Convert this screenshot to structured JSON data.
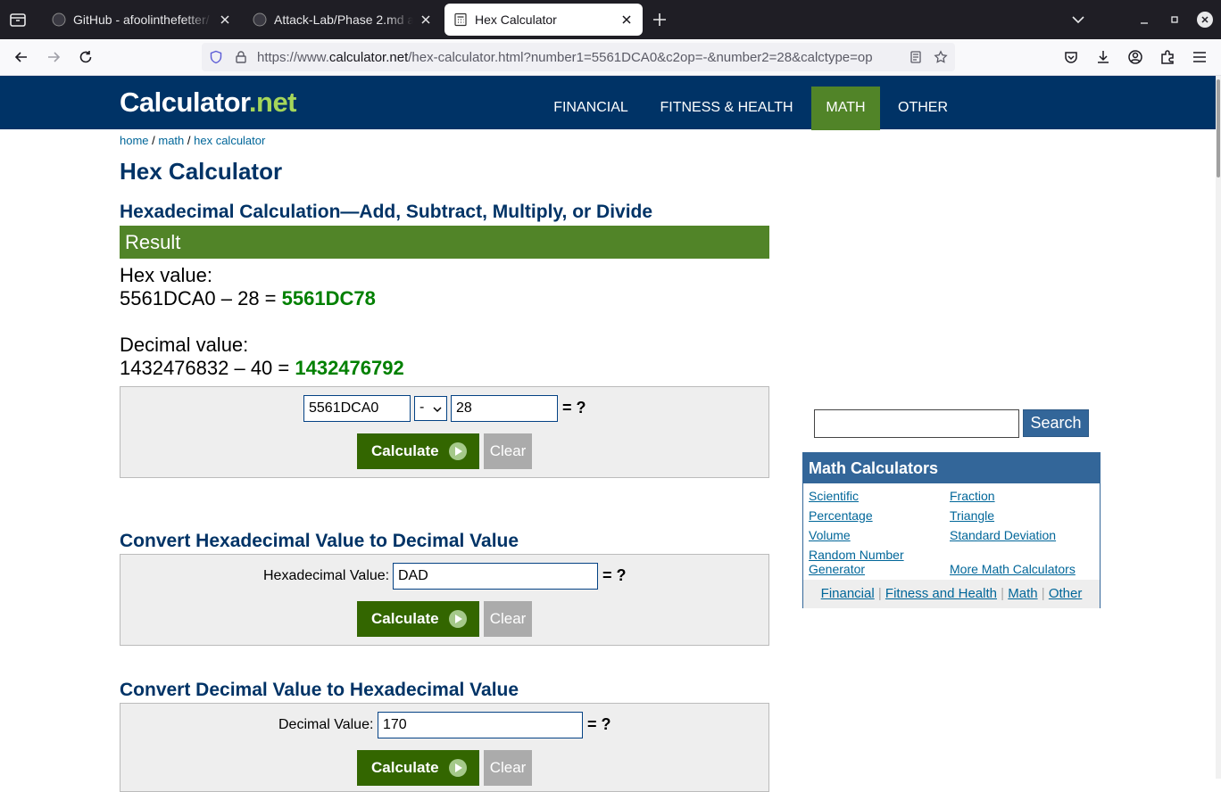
{
  "browser": {
    "tabs": [
      {
        "title": "GitHub - afoolinthefetter/",
        "active": false
      },
      {
        "title": "Attack-Lab/Phase 2.md at",
        "active": false
      },
      {
        "title": "Hex Calculator",
        "active": true
      }
    ],
    "url": {
      "prefix": "https://www.",
      "domain": "calculator.net",
      "rest": "/hex-calculator.html?number1=5561DCA0&c2op=-&number2=28&calctype=op"
    }
  },
  "site": {
    "logo_main": "Calculator",
    "logo_tld": ".net",
    "nav": [
      "FINANCIAL",
      "FITNESS & HEALTH",
      "MATH",
      "OTHER"
    ],
    "nav_selected": "MATH",
    "breadcrumb": [
      "home",
      "math",
      "hex calculator"
    ]
  },
  "page": {
    "title": "Hex Calculator",
    "calc_heading": "Hexadecimal Calculation—Add, Subtract, Multiply, or Divide",
    "result_label": "Result",
    "hex_label": "Hex value:",
    "hex_expr": "5561DCA0 – 28 = ",
    "hex_answer": "5561DC78",
    "dec_label": "Decimal value:",
    "dec_expr": "1432476832 – 40 = ",
    "dec_answer": "1432476792",
    "calc_form": {
      "number1": "5561DCA0",
      "operator": "-",
      "number2": "28",
      "eq": "= ?"
    },
    "calculate_label": "Calculate",
    "clear_label": "Clear",
    "hex2dec_heading": "Convert Hexadecimal Value to Decimal Value",
    "hex2dec_label": "Hexadecimal Value:",
    "hex2dec_value": "DAD",
    "dec2hex_heading": "Convert Decimal Value to Hexadecimal Value",
    "dec2hex_label": "Decimal Value:",
    "dec2hex_value": "170"
  },
  "sidebar": {
    "search_label": "Search",
    "box_title": "Math Calculators",
    "links_left": [
      "Scientific",
      "Percentage",
      "Volume",
      "Random Number Generator"
    ],
    "links_right": [
      "Fraction",
      "Triangle",
      "Standard Deviation",
      "More Math Calculators"
    ],
    "footer": [
      "Financial",
      "Fitness and Health",
      "Math",
      "Other"
    ]
  },
  "colors": {
    "header": "#003366",
    "accent_green": "#518428",
    "answer_green": "#008000",
    "sidebar_blue": "#336699"
  }
}
